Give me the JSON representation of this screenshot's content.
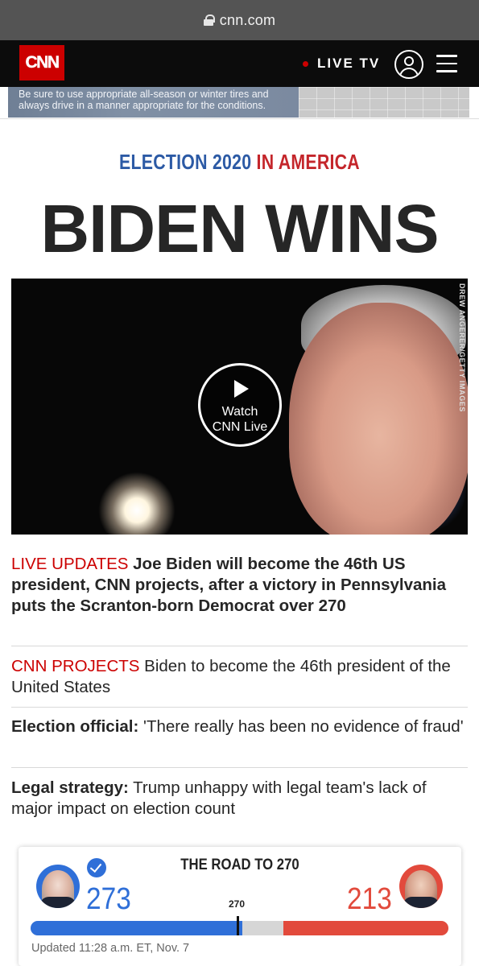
{
  "browser": {
    "url": "cnn.com"
  },
  "header": {
    "logo": "CNN",
    "live_tv": "LIVE TV",
    "colors": {
      "brand": "#cc0000",
      "bar": "#0c0c0c"
    }
  },
  "ad": {
    "text": "Be sure to use appropriate all-season or winter tires and always drive in a manner appropriate for the conditions."
  },
  "kicker": {
    "part1": "ELECTION 2020",
    "part2": " IN AMERICA"
  },
  "headline": "BIDEN WINS",
  "hero": {
    "credit": "DREW ANGERER/GETTY IMAGES",
    "play_label_line1": "Watch",
    "play_label_line2": "CNN Live"
  },
  "stories": [
    {
      "tag": "LIVE UPDATES",
      "text": "Joe Biden will become the 46th US president, CNN projects, after a victory in Pennsylvania puts the Scranton-born Democrat over 270"
    },
    {
      "tag": "CNN PROJECTS",
      "text": " Biden to become the 46th president of the United States"
    },
    {
      "lead": "Election official:",
      "text": " 'There really has been no evidence of fraud'"
    },
    {
      "lead": "Legal strategy:",
      "text": " Trump unhappy with legal team's lack of major impact on election count"
    }
  ],
  "road_to_270": {
    "title": "THE ROAD TO 270",
    "dem_votes": "273",
    "rep_votes": "213",
    "target": "270",
    "total": 538,
    "dem_value": 273,
    "rep_value": 213,
    "updated": "Updated 11:28 a.m. ET, Nov. 7",
    "colors": {
      "dem": "#2f6fd8",
      "rep": "#e24a3c",
      "undecided": "#d6d6d6"
    }
  }
}
